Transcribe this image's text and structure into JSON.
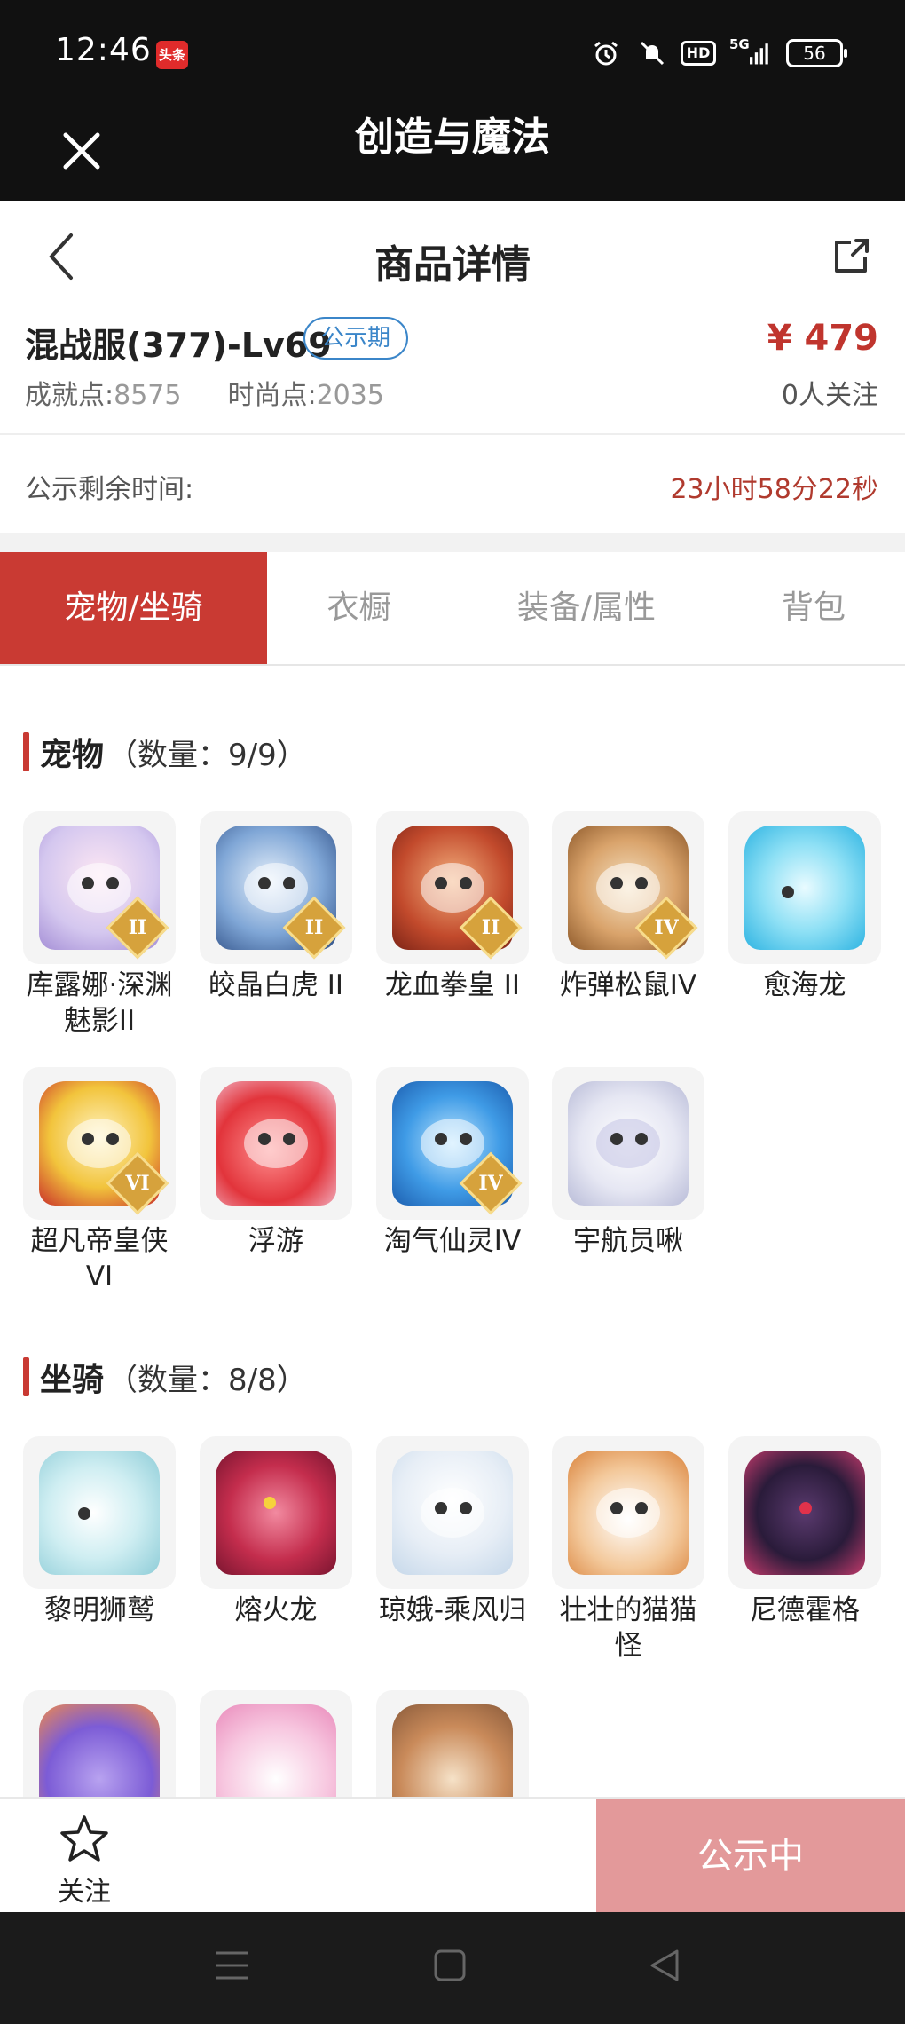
{
  "status_bar": {
    "time": "12:46",
    "app_badge": "头条",
    "network": "5G",
    "hd": "HD",
    "battery": "56"
  },
  "app_bar": {
    "title": "创造与魔法"
  },
  "header": {
    "title": "商品详情"
  },
  "product": {
    "server": "混战服(377)-Lv69",
    "phase": "公示期",
    "price": "¥ 479",
    "achievement_label": "成就点:",
    "achievement_value": "8575",
    "fashion_label": "时尚点:",
    "fashion_value": "2035",
    "followers": "0人关注"
  },
  "countdown": {
    "label": "公示剩余时间:",
    "value": "23小时58分22秒"
  },
  "tabs": [
    {
      "label": "宠物/坐骑",
      "active": true
    },
    {
      "label": "衣橱"
    },
    {
      "label": "装备/属性"
    },
    {
      "label": "背包"
    }
  ],
  "pets": {
    "title": "宠物",
    "count": "（数量：9/9）",
    "items": [
      {
        "name": "库露娜·深渊魅影II",
        "rank": "II"
      },
      {
        "name": "皎晶白虎 II",
        "rank": "II"
      },
      {
        "name": "龙血拳皇 II",
        "rank": "II"
      },
      {
        "name": "炸弹松鼠IV",
        "rank": "IV"
      },
      {
        "name": "愈海龙",
        "rank": ""
      },
      {
        "name": "超凡帝皇侠VI",
        "rank": "VI"
      },
      {
        "name": "浮游",
        "rank": ""
      },
      {
        "name": "淘气仙灵IV",
        "rank": "IV"
      },
      {
        "name": "宇航员啾",
        "rank": ""
      }
    ]
  },
  "mounts": {
    "title": "坐骑",
    "count": "（数量：8/8）",
    "items": [
      {
        "name": "黎明狮鹫"
      },
      {
        "name": "熔火龙"
      },
      {
        "name": "琼娥-乘风归"
      },
      {
        "name": "壮壮的猫猫怪"
      },
      {
        "name": "尼德霍格"
      },
      {
        "name": ""
      },
      {
        "name": ""
      },
      {
        "name": ""
      }
    ]
  },
  "bottom": {
    "follow_label": "关注",
    "status_label": "公示中"
  },
  "colors": {
    "accent": "#c93a33",
    "price": "#c0352e",
    "badge_blue": "#3b86c9",
    "status_btn": "#e3999a"
  },
  "icons": {
    "close": "close-icon",
    "back": "chevron-left-icon",
    "share": "share-icon",
    "follow": "star-icon",
    "nav_menu": "menu-icon",
    "nav_home": "square-icon",
    "nav_back": "triangle-back-icon"
  }
}
